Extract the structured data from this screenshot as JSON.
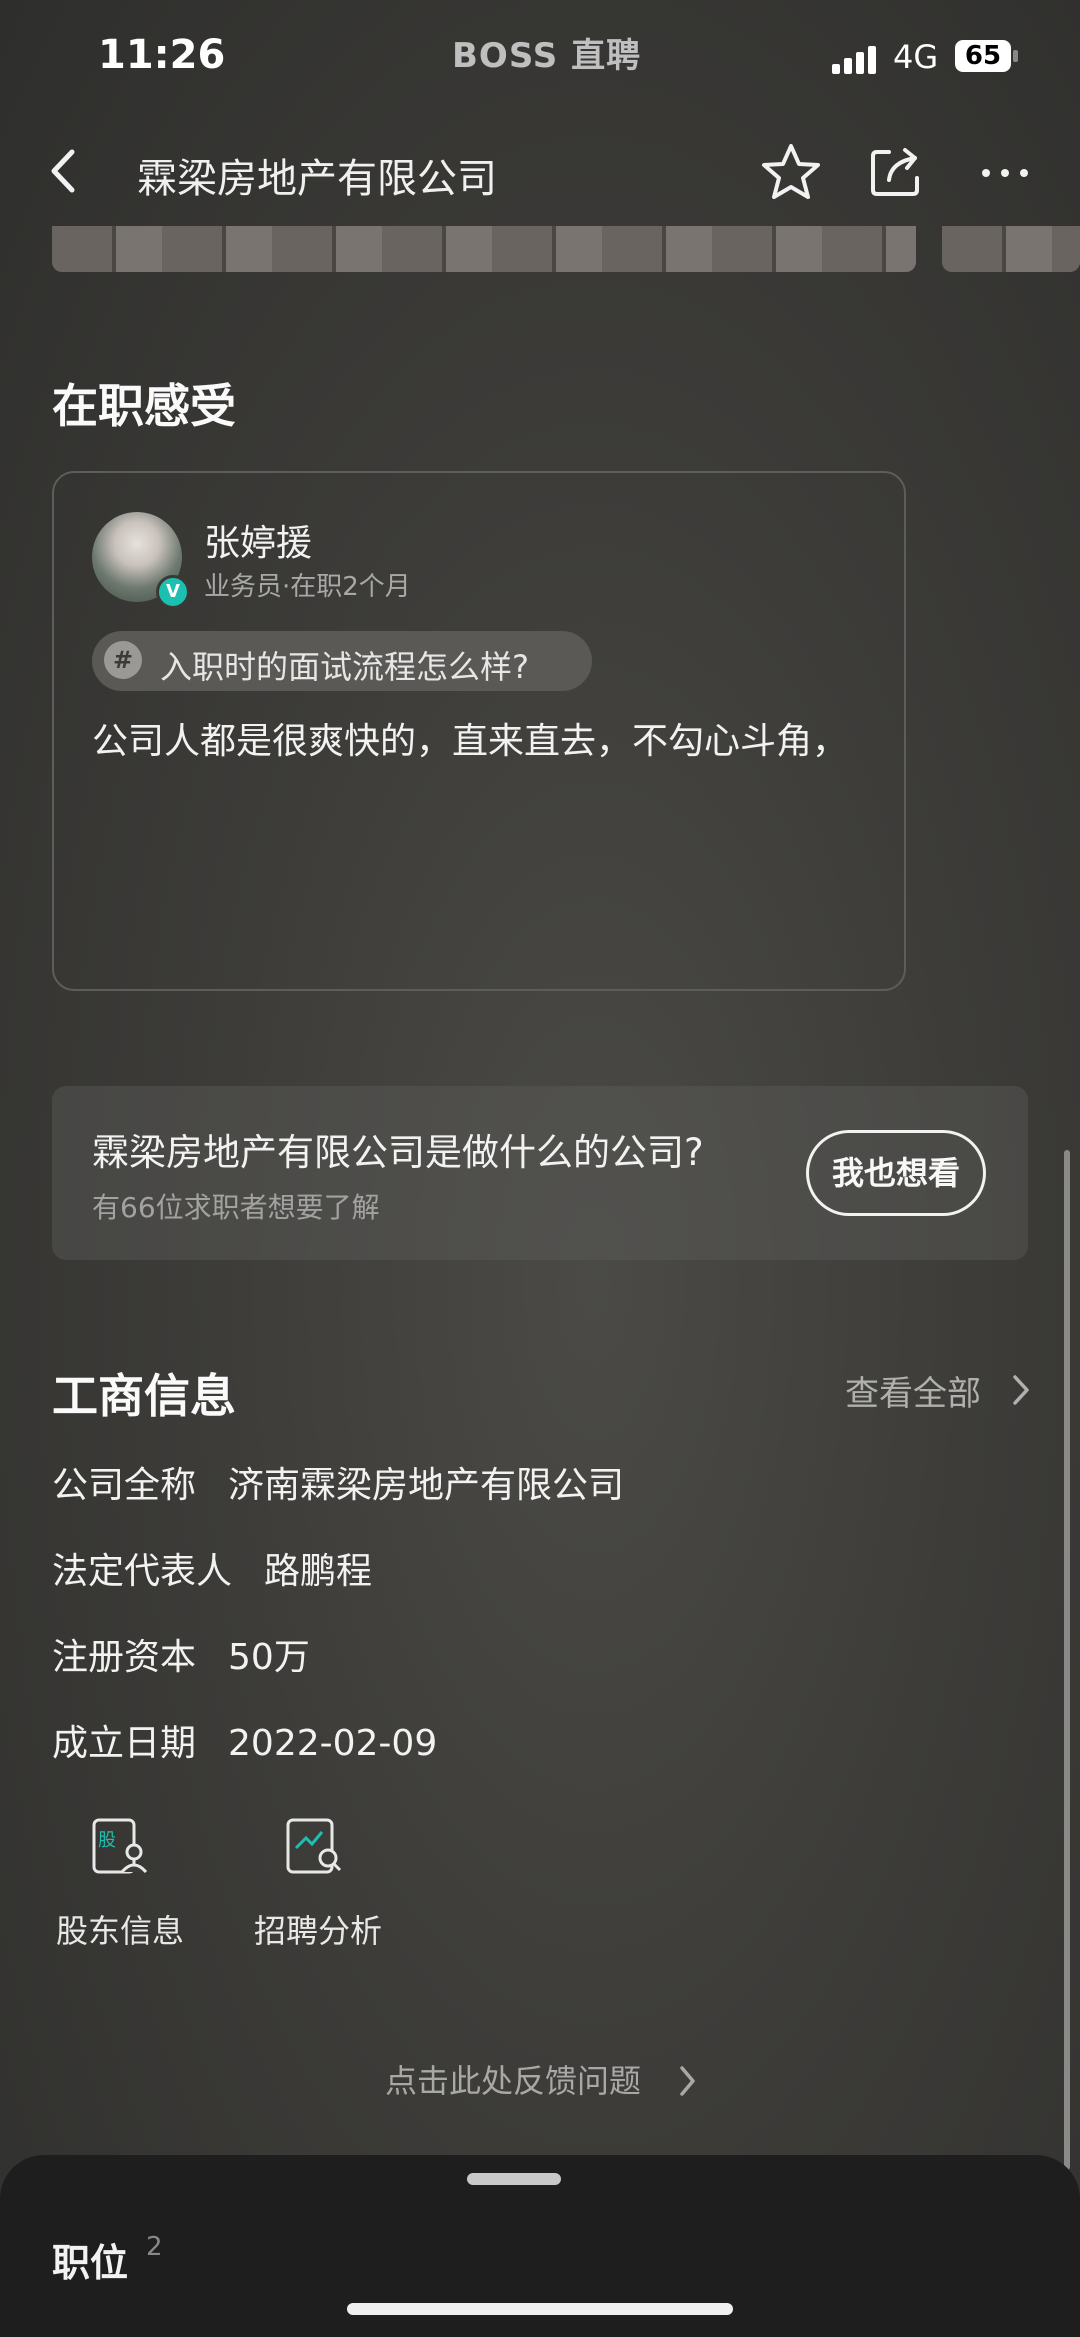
{
  "status_bar": {
    "time": "11:26",
    "app_name": "BOSS 直聘",
    "network": "4G",
    "battery": "65"
  },
  "nav": {
    "title": "霖梁房地产有限公司"
  },
  "reviews_section": {
    "title": "在职感受",
    "review": {
      "name": "张婷援",
      "role": "业务员·在职2个月",
      "verified_mark": "V",
      "tag_icon": "#",
      "tag": "入职时的面试流程怎么样?",
      "body": "公司人都是很爽快的，直来直去，不勾心斗角，"
    }
  },
  "question": {
    "title": "霖梁房地产有限公司是做什么的公司?",
    "subtitle": "有66位求职者想要了解",
    "button": "我也想看"
  },
  "business": {
    "title": "工商信息",
    "view_all": "查看全部",
    "rows": [
      {
        "label": "公司全称",
        "value": "济南霖梁房地产有限公司"
      },
      {
        "label": "法定代表人",
        "value": "路鹏程"
      },
      {
        "label": "注册资本",
        "value": "50万"
      },
      {
        "label": "成立日期",
        "value": "2022-02-09"
      }
    ],
    "tools": [
      {
        "label": "股东信息",
        "icon": "shareholder-icon",
        "icon_glyph": "股"
      },
      {
        "label": "招聘分析",
        "icon": "recruit-analysis-icon"
      }
    ]
  },
  "feedback": "点击此处反馈问题",
  "jobs_sheet": {
    "title": "职位",
    "count": "2"
  },
  "colors": {
    "accent": "#1dbfb0",
    "background": "#3d3c39",
    "sheet": "#1e1e1f"
  }
}
